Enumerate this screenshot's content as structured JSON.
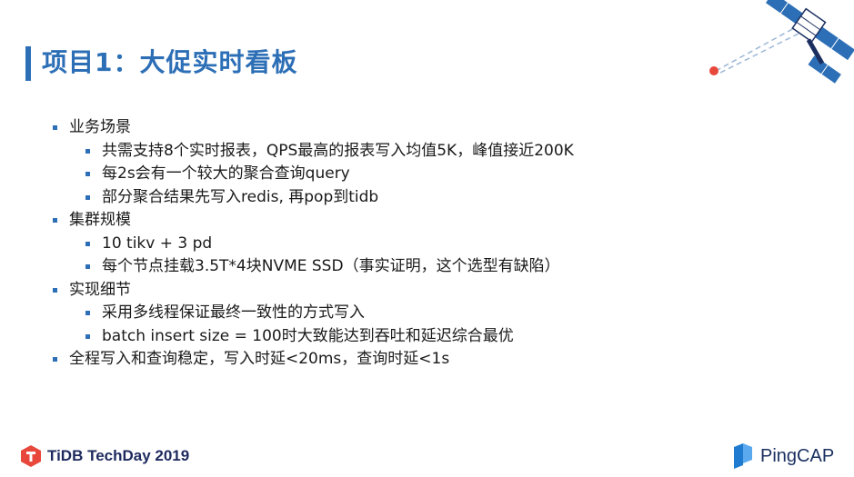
{
  "slide": {
    "title": "项目1：大促实时看板"
  },
  "bullets": [
    {
      "level": 1,
      "text": "业务场景"
    },
    {
      "level": 2,
      "text": "共需支持8个实时报表，QPS最高的报表写入均值5K，峰值接近200K"
    },
    {
      "level": 2,
      "text": "每2s会有一个较大的聚合查询query"
    },
    {
      "level": 2,
      "text": "部分聚合结果先写入redis, 再pop到tidb"
    },
    {
      "level": 1,
      "text": "集群规模"
    },
    {
      "level": 2,
      "text": "10 tikv + 3 pd"
    },
    {
      "level": 2,
      "text": "每个节点挂载3.5T*4块NVME SSD（事实证明，这个选型有缺陷）"
    },
    {
      "level": 1,
      "text": "实现细节"
    },
    {
      "level": 2,
      "text": "采用多线程保证最终一致性的方式写入"
    },
    {
      "level": 2,
      "text": "batch insert size = 100时大致能达到吞吐和延迟综合最优"
    },
    {
      "level": 1,
      "text": "全程写入和查询稳定，写入时延<20ms，查询时延<1s"
    }
  ],
  "footer": {
    "left_brand": "TiDB TechDay 2019",
    "right_brand": "PingCAP"
  },
  "colors": {
    "accent": "#2D6FB6",
    "title": "#2D6FB6",
    "satellite_dot": "#E8473C",
    "tidb_logo": "#E8473C",
    "pingcap_logo": "#1E7BD0"
  },
  "icons": {
    "decoration": "satellite-icon",
    "left_logo": "tidb-logo-icon",
    "right_logo": "pingcap-logo-icon"
  }
}
